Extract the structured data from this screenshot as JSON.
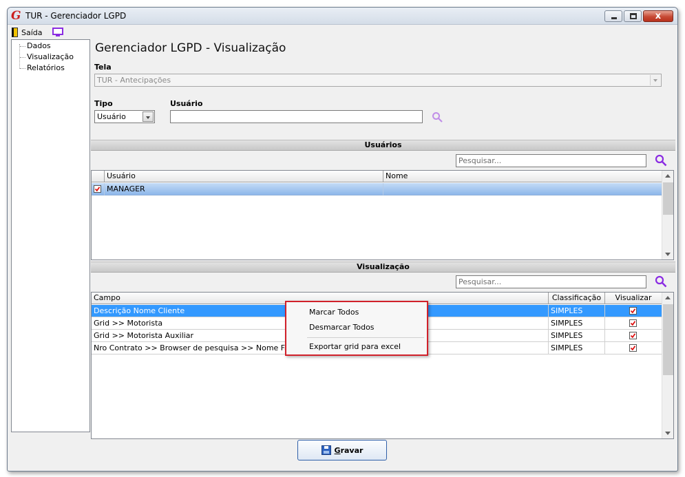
{
  "window": {
    "title": "TUR - Gerenciador LGPD",
    "close_glyph": "x"
  },
  "menu": {
    "exit_label": "Saída"
  },
  "tree": {
    "items": [
      "Dados",
      "Visualização",
      "Relatórios"
    ]
  },
  "page": {
    "title": "Gerenciador LGPD - Visualização"
  },
  "form": {
    "tela_label": "Tela",
    "tela_value": "TUR - Antecipações",
    "tipo_label": "Tipo",
    "tipo_value": "Usuário",
    "usuario_label": "Usuário",
    "usuario_value": ""
  },
  "users_section": {
    "title": "Usuários",
    "search_placeholder": "Pesquisar...",
    "columns": [
      "Usuário",
      "Nome"
    ],
    "rows": [
      {
        "checked": true,
        "usuario": "MANAGER",
        "nome": ""
      }
    ]
  },
  "view_section": {
    "title": "Visualização",
    "search_placeholder": "Pesquisar...",
    "columns": [
      "Campo",
      "Classificação",
      "Visualizar"
    ],
    "rows": [
      {
        "campo": "Descrição Nome Cliente",
        "classificacao": "SIMPLES",
        "visualizar": true
      },
      {
        "campo": "Grid >> Motorista",
        "classificacao": "SIMPLES",
        "visualizar": true
      },
      {
        "campo": "Grid >> Motorista Auxiliar",
        "classificacao": "SIMPLES",
        "visualizar": true
      },
      {
        "campo": "Nro Contrato >> Browser de pesquisa >> Nome Fantasia",
        "classificacao": "SIMPLES",
        "visualizar": true
      }
    ]
  },
  "context_menu": {
    "items": [
      "Marcar Todos",
      "Desmarcar Todos",
      "Exportar grid para excel"
    ]
  },
  "footer": {
    "save_first": "G",
    "save_rest": "ravar"
  },
  "colors": {
    "selection": "#3399ff",
    "highlight_border": "#d1202a",
    "search_icon": "#8a2be2",
    "check": "#d11"
  },
  "icons": [
    "app-logo-icon",
    "door-icon",
    "monitor-icon",
    "search-icon",
    "disk-icon",
    "checkbox-icon"
  ]
}
